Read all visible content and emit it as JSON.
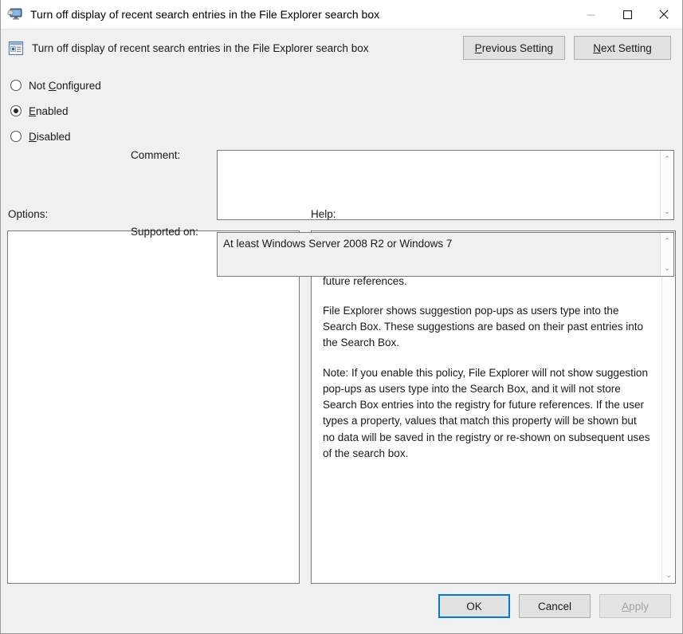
{
  "window": {
    "title": "Turn off display of recent search entries in the File Explorer search box",
    "icon": "computer-monitor-icon",
    "controls": {
      "minimize": "minimize-icon",
      "maximize": "maximize-icon",
      "close": "close-icon"
    }
  },
  "header": {
    "icon": "policy-setting-icon",
    "title": "Turn off display of recent search entries in the File Explorer search box",
    "previous_button": {
      "accel": "P",
      "rest": "revious Setting"
    },
    "next_button": {
      "accel": "N",
      "rest": "ext Setting"
    }
  },
  "state": {
    "options": [
      {
        "id": "not-configured",
        "pre": "Not ",
        "accel": "C",
        "post": "onfigured",
        "checked": false
      },
      {
        "id": "enabled",
        "pre": "",
        "accel": "E",
        "post": "nabled",
        "checked": true
      },
      {
        "id": "disabled",
        "pre": "",
        "accel": "D",
        "post": "isabled",
        "checked": false
      }
    ]
  },
  "comment": {
    "label": "Comment:",
    "value": "",
    "placeholder": ""
  },
  "supported": {
    "label": "Supported on:",
    "value": "At least Windows Server 2008 R2 or Windows 7"
  },
  "sections": {
    "options_label": "Options:",
    "help_label": "Help:"
  },
  "options_panel": {
    "value": ""
  },
  "help": {
    "paragraphs": [
      "Disables suggesting recent queries for the Search Box and prevents entries into the Search Box from being stored in the registry for future references.",
      "File Explorer shows suggestion pop-ups as users type into the Search Box.  These suggestions are based on their past entries into the Search Box.",
      "Note: If you enable this policy, File Explorer will not show suggestion pop-ups as users type into the Search Box, and it will not store Search Box entries into the registry for future references.  If the user types a property, values that match this property will be shown but no data will be saved in the registry or re-shown on subsequent uses of the search box."
    ]
  },
  "footer": {
    "ok": "OK",
    "cancel": "Cancel",
    "apply_accel": "A",
    "apply_rest": "pply"
  },
  "scrollbar": {
    "up_arrow": "⌃",
    "down_arrow": "⌄"
  },
  "colors": {
    "accent": "#0078d7",
    "dialog_face": "#f0f0f0",
    "button_face": "#e1e1e1",
    "field_white": "#ffffff",
    "disabled_text": "#a3a3a3"
  }
}
